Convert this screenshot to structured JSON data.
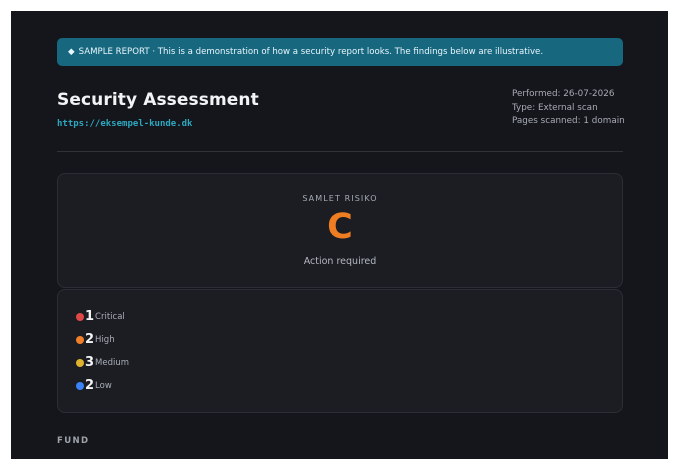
{
  "banner": {
    "icon": "diamond-icon",
    "text": "SAMPLE REPORT · This is a demonstration of how a security report looks. The findings below are illustrative."
  },
  "header": {
    "title": "Security Assessment",
    "url": "https://eksempel-kunde.dk",
    "performed": "Performed: 26-07-2026",
    "type": "Type: External scan",
    "pages_scanned": "Pages scanned: 1 domain"
  },
  "overall": {
    "label": "SAMLET RISIKO",
    "grade": "C",
    "status": "Action required",
    "grade_color": "#ef7d22"
  },
  "counts": [
    {
      "count": "1",
      "label": "Critical",
      "color": "#e04848"
    },
    {
      "count": "2",
      "label": "High",
      "color": "#f07f2a"
    },
    {
      "count": "3",
      "label": "Medium",
      "color": "#e0b22f"
    },
    {
      "count": "2",
      "label": "Low",
      "color": "#3b82f6"
    }
  ],
  "section": {
    "heading": "FUND"
  },
  "colors": {
    "background": "#15161b",
    "banner": "#17677f",
    "accent": "#2ea7c0"
  }
}
